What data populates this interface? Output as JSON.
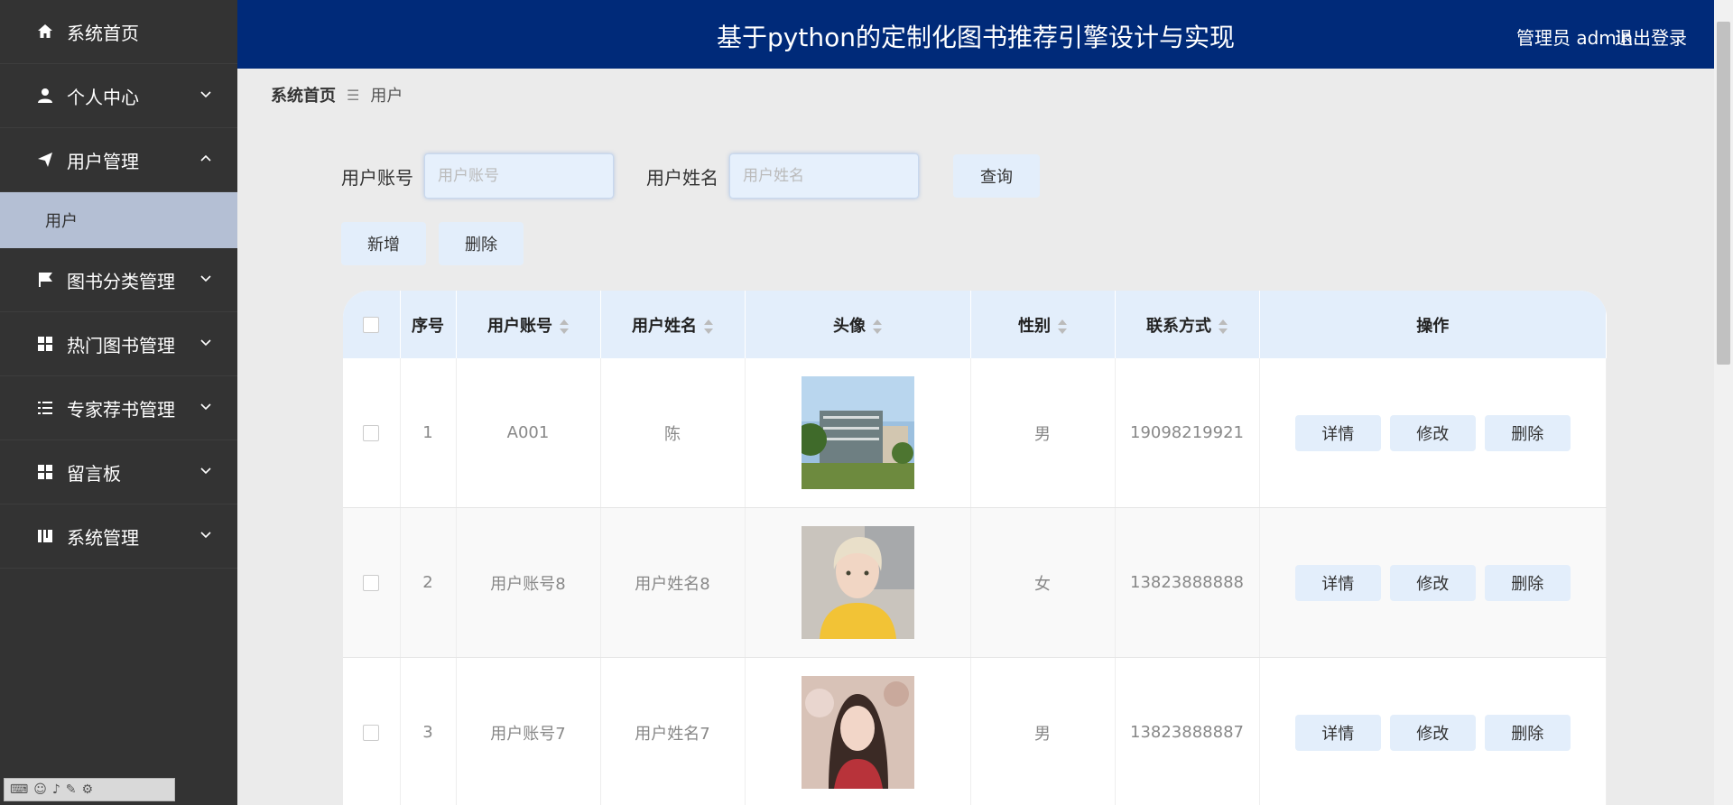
{
  "sidebar": {
    "items": [
      {
        "label": "系统首页",
        "icon": "home-icon",
        "expand": ""
      },
      {
        "label": "个人中心",
        "icon": "user-icon",
        "expand": "down"
      },
      {
        "label": "用户管理",
        "icon": "send-icon",
        "expand": "up"
      },
      {
        "label": "图书分类管理",
        "icon": "flag-icon",
        "expand": "down"
      },
      {
        "label": "热门图书管理",
        "icon": "grid-icon",
        "expand": "down"
      },
      {
        "label": "专家荐书管理",
        "icon": "list-icon",
        "expand": "down"
      },
      {
        "label": "留言板",
        "icon": "grid-icon",
        "expand": "down"
      },
      {
        "label": "系统管理",
        "icon": "book-icon",
        "expand": "down"
      }
    ],
    "sub_item": "用户"
  },
  "header": {
    "title": "基于python的定制化图书推荐引擎设计与实现",
    "user": "管理员 admin",
    "logout": "退出登录",
    "bg": "#002a79"
  },
  "breadcrumb": {
    "home": "系统首页",
    "current": "用户"
  },
  "search": {
    "account_label": "用户账号",
    "account_placeholder": "用户账号",
    "name_label": "用户姓名",
    "name_placeholder": "用户姓名",
    "query_label": "查询"
  },
  "actions": {
    "add": "新增",
    "delete": "删除"
  },
  "table": {
    "headers": {
      "index": "序号",
      "account": "用户账号",
      "name": "用户姓名",
      "avatar": "头像",
      "gender": "性别",
      "contact": "联系方式",
      "ops": "操作"
    },
    "rows": [
      {
        "index": "1",
        "account": "A001",
        "name": "陈",
        "gender": "男",
        "contact": "19098219921",
        "avatar": "building-photo"
      },
      {
        "index": "2",
        "account": "用户账号8",
        "name": "用户姓名8",
        "gender": "女",
        "contact": "13823888888",
        "avatar": "blond-person-photo"
      },
      {
        "index": "3",
        "account": "用户账号7",
        "name": "用户姓名7",
        "gender": "男",
        "contact": "13823888887",
        "avatar": "girl-portrait-photo"
      }
    ],
    "ops": {
      "detail": "详情",
      "edit": "修改",
      "delete": "删除"
    }
  },
  "colors": {
    "accent": "#002a79",
    "button": "#e3eefb",
    "sidebar": "#333333",
    "submenu": "#b4bfd4"
  }
}
